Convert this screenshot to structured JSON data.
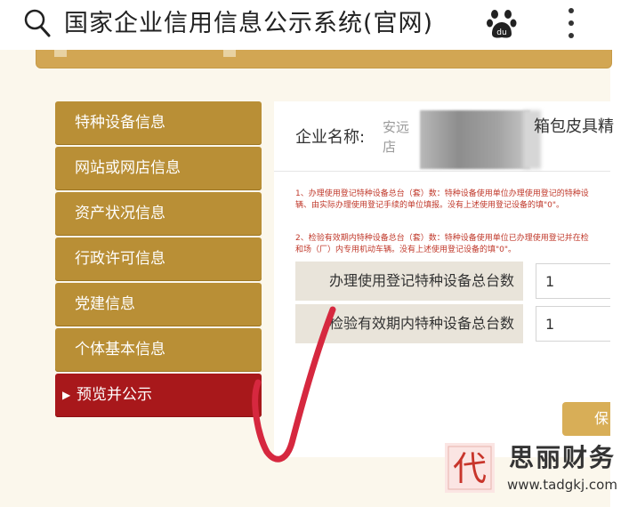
{
  "header": {
    "title": "国家企业信用信息公示系统(官网)",
    "search_icon": "search-icon",
    "app_icon": "baidu-paw-icon",
    "menu_icon": "more-vertical-icon"
  },
  "sidebar": {
    "items": [
      {
        "label": "特种设备信息"
      },
      {
        "label": "网站或网店信息"
      },
      {
        "label": "资产状况信息"
      },
      {
        "label": "行政许可信息"
      },
      {
        "label": "党建信息"
      },
      {
        "label": "个体基本信息"
      },
      {
        "label": "预览并公示",
        "active": true
      }
    ],
    "active_arrow": "▶"
  },
  "company": {
    "label": "企业名称:",
    "name_prefix": "安远\n店",
    "name_suffix": "箱包皮具精"
  },
  "notes": {
    "note1": "1、办理使用登记特种设备总台（套）数：特种设备使用单位办理使用登记的特种设\n辆、由实际办理使用登记手续的单位填报。没有上述使用登记设备的填\"0\"。",
    "note2": "2、检验有效期内特种设备总台（套）数：特种设备使用单位已办理使用登记并在检\n和场（厂）内专用机动车辆。没有上述使用登记设备的填\"0\"。"
  },
  "fields": [
    {
      "label": "办理使用登记特种设备总台数",
      "value": "1"
    },
    {
      "label": "检验有效期内特种设备总台数",
      "value": "1"
    }
  ],
  "buttons": {
    "save_label": "保"
  },
  "watermark": {
    "logo_char": "代",
    "name": "思丽财务",
    "url": "www.tadgkj.com"
  },
  "colors": {
    "sidebar_gold": "#b98f36",
    "sidebar_active_red": "#a8181b",
    "checkmark_red": "#d6283f"
  }
}
